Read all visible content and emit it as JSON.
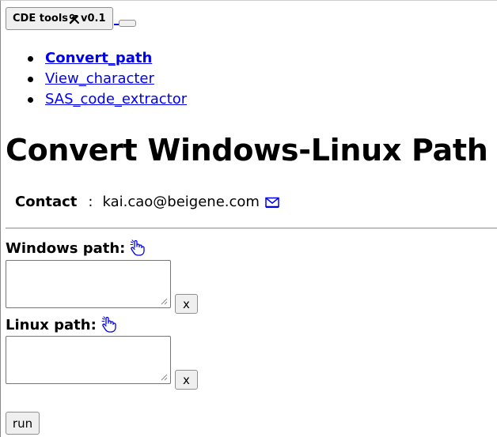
{
  "toolbar": {
    "title": "CDE tools",
    "version": " v0.1",
    "tool_icon": "hammer-wrench-icon"
  },
  "nav": {
    "items": [
      {
        "label": "Convert_path",
        "active": true
      },
      {
        "label": "View_character",
        "active": false
      },
      {
        "label": "SAS_code_extractor",
        "active": false
      }
    ]
  },
  "page": {
    "title": "Convert Windows-Linux Path"
  },
  "contact": {
    "label": "Contact",
    "separator": ":",
    "email": "kai.cao@beigene.com",
    "email_icon": "envelope-icon"
  },
  "form": {
    "windows": {
      "label": "Windows path:",
      "value": "",
      "help_icon": "pointing-hand-icon",
      "clear_label": "x"
    },
    "linux": {
      "label": "Linux path:",
      "value": "",
      "help_icon": "pointing-hand-icon",
      "clear_label": "x"
    },
    "run_label": "run"
  },
  "colors": {
    "link": "#0000ee",
    "button_bg": "#efefef",
    "button_border": "#8f8f8f"
  }
}
